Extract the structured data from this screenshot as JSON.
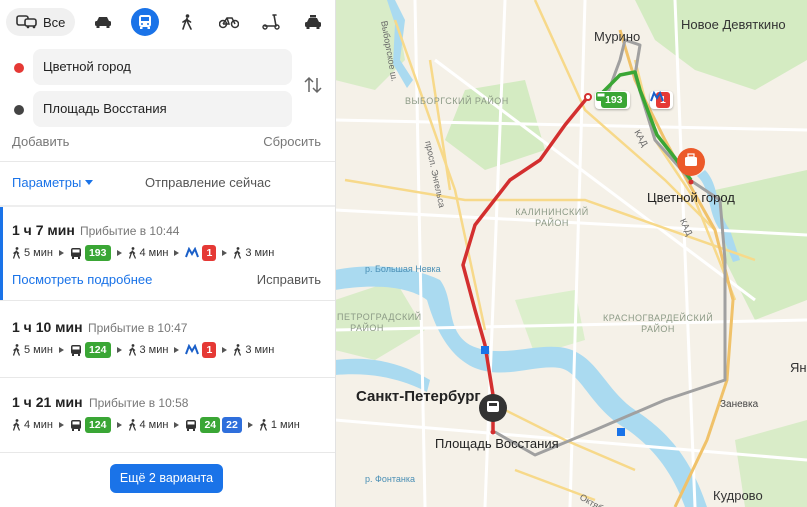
{
  "modes": {
    "all_label": "Все",
    "items": [
      "car-icon",
      "bus-icon",
      "walk-icon",
      "bike-icon",
      "scooter-icon",
      "taxi-icon"
    ],
    "active": "bus-icon",
    "accent": "#1a73e8"
  },
  "route_points": {
    "from": {
      "value": "Цветной город",
      "color": "#e53935"
    },
    "to": {
      "value": "Площадь Восстания",
      "color": "#444444"
    }
  },
  "actions": {
    "add": "Добавить",
    "reset": "Сбросить"
  },
  "options": {
    "params": "Параметры",
    "departure": "Отправление сейчас"
  },
  "routes": [
    {
      "duration": "1 ч 7 мин",
      "arrival": "Прибытие в 10:44",
      "steps": {
        "walk1": "5 мин",
        "bus": "193",
        "walk2": "4 мин",
        "metro": "1",
        "walk3": "3 мин"
      },
      "details_link": "Посмотреть подробнее",
      "fix_link": "Исправить"
    },
    {
      "duration": "1 ч 10 мин",
      "arrival": "Прибытие в 10:47",
      "steps": {
        "walk1": "5 мин",
        "bus": "124",
        "walk2": "3 мин",
        "metro": "1",
        "walk3": "3 мин"
      }
    },
    {
      "duration": "1 ч 21 мин",
      "arrival": "Прибытие в 10:58",
      "steps": {
        "walk1": "4 мин",
        "bus": "124",
        "walk2": "4 мин",
        "bus2a": "24",
        "bus2b": "22",
        "walk3": "1 мин"
      }
    }
  ],
  "more_button": "Ещё 2 варианта",
  "map": {
    "labels": {
      "murino": "Мурино",
      "novoe_devyatkino": "Новое Девяткино",
      "vyborgsky": "ВЫБОРГСКИЙ РАЙОН",
      "kalininsky": "КАЛИНИНСКИЙ РАЙОН",
      "petrogradsky": "ПЕТРОГРАДСКИЙ РАЙОН",
      "krasnogvardeysky": "КРАСНОГВАРДЕЙСКИЙ РАЙОН",
      "vyborgskoe_sh": "Выборгское ш.",
      "engelsa": "просп. Энгельса",
      "kad1": "КАД",
      "kad2": "КАД",
      "bolshaya_nevka": "р. Большая Невка",
      "fontanka": "р. Фонтанка",
      "oktyabrskaya": "Октябр",
      "spb": "Санкт-Петербург",
      "ploshchad": "Площадь Восстания",
      "tsvetnoy": "Цветной город",
      "zanevka": "Заневка",
      "kudrovo": "Кудрово",
      "yan": "Ян"
    },
    "chip_bus": "193",
    "chip_metro": "1",
    "colors": {
      "bus_route": "#d32f2f",
      "walk_route": "#9e9e9e",
      "green_route": "#3aa635",
      "water": "#aadaf0",
      "park": "#c8e6b4"
    }
  }
}
